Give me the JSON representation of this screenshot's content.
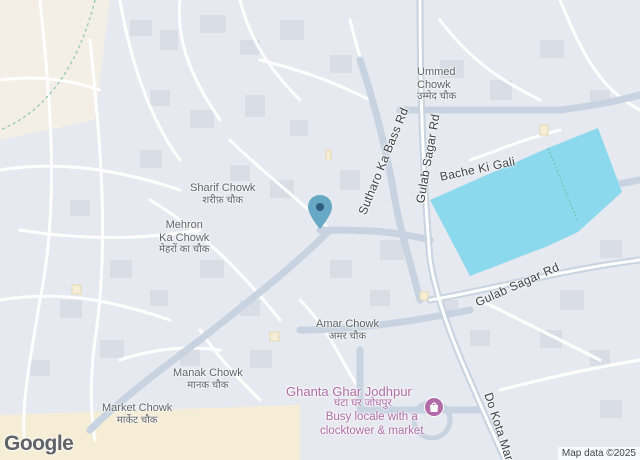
{
  "map": {
    "attribution": "Map data ©2025",
    "logo": "Google",
    "colors": {
      "background": "#e6e9ef",
      "road": "#ffffff",
      "main_road": "#c7d3e0",
      "water": "#8cd9ee",
      "poi": "#b06ba8",
      "pin": "#66a8c5",
      "sand": "#f6edd6"
    },
    "pin_icon": "location-pin-icon",
    "places": {
      "ummed": {
        "en": "Ummed\nChowk",
        "hi": "उम्मेद चौक"
      },
      "sharif": {
        "en": "Sharif Chowk",
        "hi": "शरीफ़ चौक"
      },
      "mehron": {
        "en": "Mehron\nKa Chowk",
        "hi": "मेहरों का चौक"
      },
      "amar": {
        "en": "Amar Chowk",
        "hi": "अमर चौक"
      },
      "manak": {
        "en": "Manak Chowk",
        "hi": "मानक चौक"
      },
      "market": {
        "en": "Market Chowk",
        "hi": "मार्केट चौक"
      }
    },
    "roads": {
      "sutharo": "Sutharo Ka Bass Rd",
      "gulab_sagar_vertical": "Gulab Sagar Rd",
      "gulab_sagar_horizontal": "Gulab Sagar Rd",
      "bache_ki_gali": "Bache Ki Gali",
      "do_kota_marg": "Do Kota Marg"
    },
    "poi": {
      "title": "Ghanta Ghar Jodhpur",
      "title_hi": "घंटा घर जोधपुर",
      "description": "Busy locale with a\nclocktower & market",
      "icon": "shopping-bag-icon"
    }
  }
}
